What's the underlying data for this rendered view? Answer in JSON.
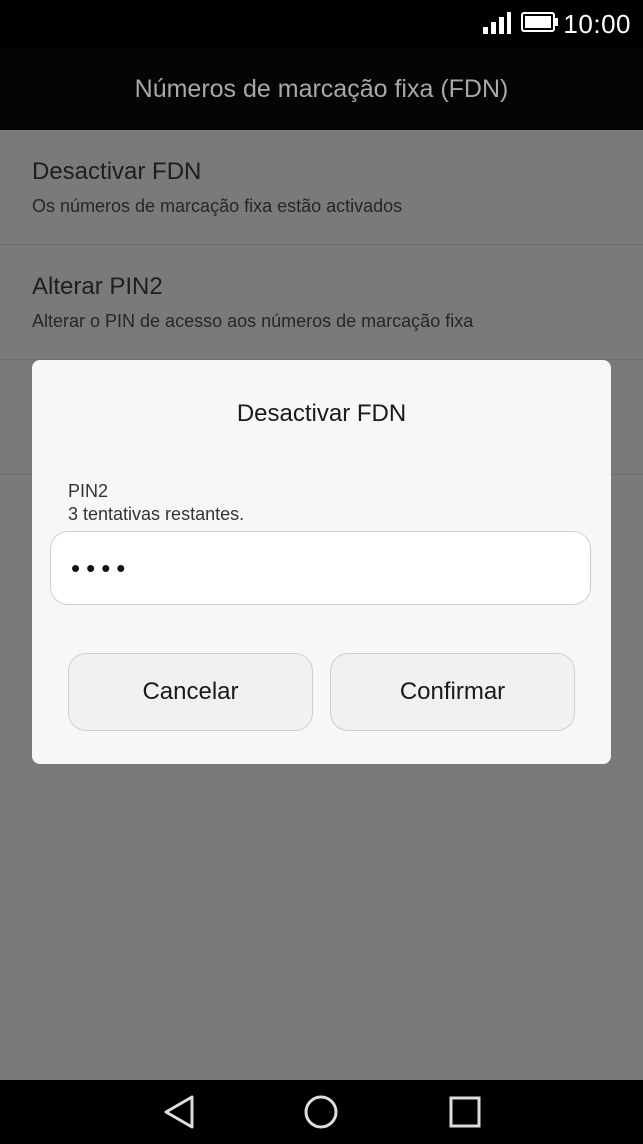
{
  "status_bar": {
    "time": "10:00",
    "signal_icon": "signal-icon",
    "battery_icon": "battery-icon"
  },
  "title_bar": {
    "title": "Números de marcação fixa (FDN)"
  },
  "list": {
    "items": [
      {
        "title": "Desactivar FDN",
        "subtitle": "Os números de marcação fixa estão activados"
      },
      {
        "title": "Alterar PIN2",
        "subtitle": "Alterar o PIN de acesso aos números de marcação fixa"
      }
    ]
  },
  "dialog": {
    "title": "Desactivar FDN",
    "pin_label": "PIN2",
    "attempts_text": "3 tentativas restantes.",
    "pin_value": "••••",
    "cancel_label": "Cancelar",
    "confirm_label": "Confirmar"
  },
  "nav_bar": {
    "back_icon": "back-icon",
    "home_icon": "home-icon",
    "recents_icon": "recents-icon"
  },
  "colors": {
    "scrim": "#7a7a7a",
    "dialog_bg": "#f7f7f7",
    "bar_bg": "#000000"
  }
}
